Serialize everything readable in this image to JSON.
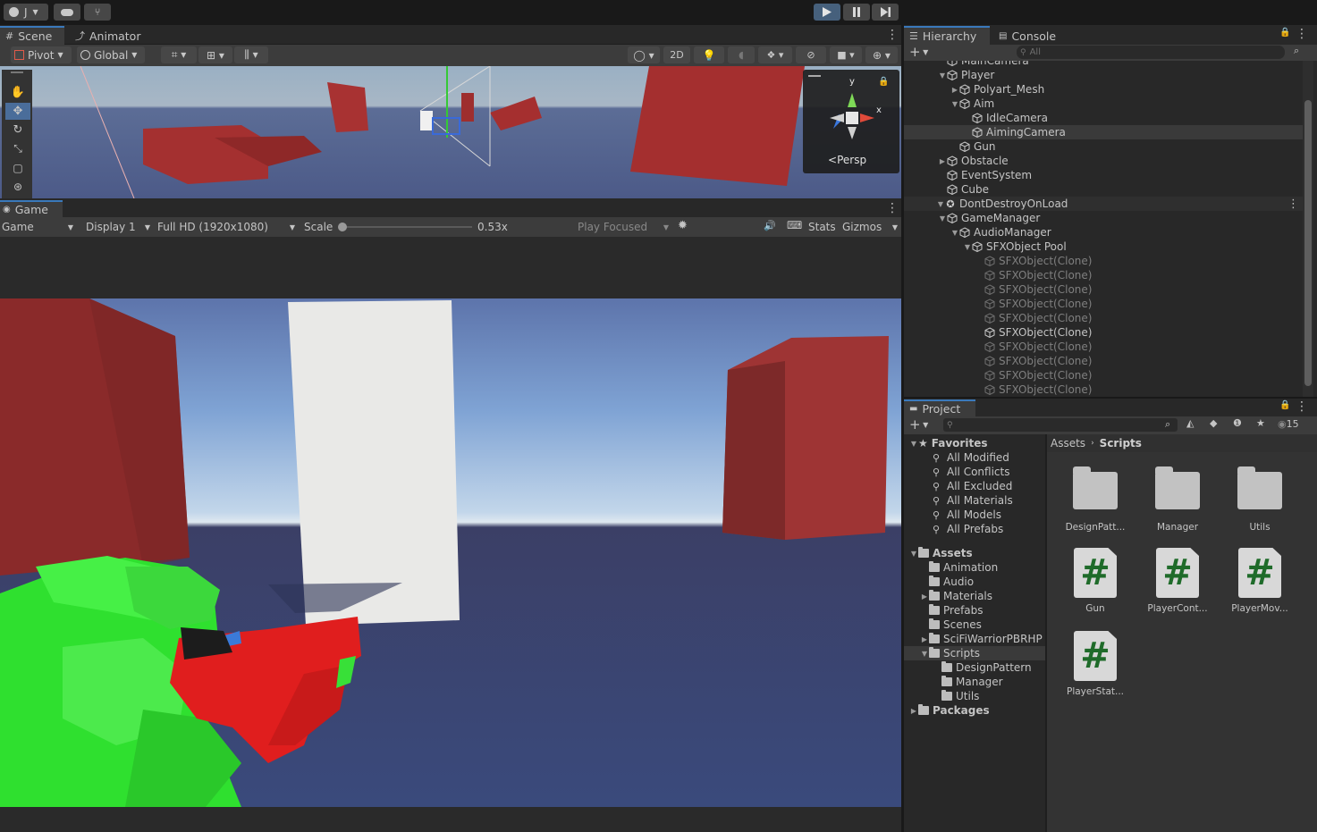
{
  "topbar": {
    "account_label": "J",
    "play": "play",
    "pause": "pause",
    "step": "step"
  },
  "scene_tabs": {
    "scene": "Scene",
    "animator": "Animator"
  },
  "scene_toolbar": {
    "pivot": "Pivot",
    "global": "Global",
    "two_d": "2D"
  },
  "gizmo": {
    "projection": "Persp",
    "y": "y",
    "x": "x",
    "z": "z"
  },
  "game_tab": "Game",
  "game_toolbar": {
    "view": "Game",
    "display": "Display 1",
    "resolution": "Full HD (1920x1080)",
    "scale_label": "Scale",
    "scale_value": "0.53x",
    "scale_fraction": 0.0,
    "play_mode": "Play Focused",
    "stats": "Stats",
    "gizmos": "Gizmos"
  },
  "hierarchy": {
    "tab": "Hierarchy",
    "console_tab": "Console",
    "search_placeholder": "All",
    "items": [
      {
        "label": "MainCamera",
        "depth": 1,
        "arrow": "",
        "dim": false
      },
      {
        "label": "Player",
        "depth": 1,
        "arrow": "down",
        "dim": false
      },
      {
        "label": "Polyart_Mesh",
        "depth": 2,
        "arrow": "right",
        "dim": false
      },
      {
        "label": "Aim",
        "depth": 2,
        "arrow": "down",
        "dim": false
      },
      {
        "label": "IdleCamera",
        "depth": 3,
        "arrow": "",
        "dim": false
      },
      {
        "label": "AimingCamera",
        "depth": 3,
        "arrow": "",
        "dim": false,
        "selected": true
      },
      {
        "label": "Gun",
        "depth": 2,
        "arrow": "",
        "dim": false
      },
      {
        "label": "Obstacle",
        "depth": 1,
        "arrow": "right",
        "dim": false
      },
      {
        "label": "EventSystem",
        "depth": 1,
        "arrow": "",
        "dim": false
      },
      {
        "label": "Cube",
        "depth": 1,
        "arrow": "",
        "dim": false
      },
      {
        "label": "DontDestroyOnLoad",
        "depth": 0,
        "arrow": "down",
        "dim": false,
        "scene": true
      },
      {
        "label": "GameManager",
        "depth": 1,
        "arrow": "down",
        "dim": false
      },
      {
        "label": "AudioManager",
        "depth": 2,
        "arrow": "down",
        "dim": false
      },
      {
        "label": "SFXObject Pool",
        "depth": 3,
        "arrow": "down",
        "dim": false
      },
      {
        "label": "SFXObject(Clone)",
        "depth": 4,
        "arrow": "",
        "dim": true
      },
      {
        "label": "SFXObject(Clone)",
        "depth": 4,
        "arrow": "",
        "dim": true
      },
      {
        "label": "SFXObject(Clone)",
        "depth": 4,
        "arrow": "",
        "dim": true
      },
      {
        "label": "SFXObject(Clone)",
        "depth": 4,
        "arrow": "",
        "dim": true
      },
      {
        "label": "SFXObject(Clone)",
        "depth": 4,
        "arrow": "",
        "dim": true
      },
      {
        "label": "SFXObject(Clone)",
        "depth": 4,
        "arrow": "",
        "dim": false
      },
      {
        "label": "SFXObject(Clone)",
        "depth": 4,
        "arrow": "",
        "dim": true
      },
      {
        "label": "SFXObject(Clone)",
        "depth": 4,
        "arrow": "",
        "dim": true
      },
      {
        "label": "SFXObject(Clone)",
        "depth": 4,
        "arrow": "",
        "dim": true
      },
      {
        "label": "SFXObject(Clone)",
        "depth": 4,
        "arrow": "",
        "dim": true
      }
    ]
  },
  "project": {
    "tab": "Project",
    "hidden_count": "15",
    "favorites_label": "Favorites",
    "favorites": [
      "All Modified",
      "All Conflicts",
      "All Excluded",
      "All Materials",
      "All Models",
      "All Prefabs"
    ],
    "assets_label": "Assets",
    "assets": [
      {
        "label": "Animation",
        "depth": 1,
        "arrow": ""
      },
      {
        "label": "Audio",
        "depth": 1,
        "arrow": ""
      },
      {
        "label": "Materials",
        "depth": 1,
        "arrow": "right"
      },
      {
        "label": "Prefabs",
        "depth": 1,
        "arrow": ""
      },
      {
        "label": "Scenes",
        "depth": 1,
        "arrow": ""
      },
      {
        "label": "SciFiWarriorPBRHP",
        "depth": 1,
        "arrow": "right"
      },
      {
        "label": "Scripts",
        "depth": 1,
        "arrow": "down",
        "selected": true
      },
      {
        "label": "DesignPattern",
        "depth": 2,
        "arrow": ""
      },
      {
        "label": "Manager",
        "depth": 2,
        "arrow": ""
      },
      {
        "label": "Utils",
        "depth": 2,
        "arrow": ""
      }
    ],
    "packages_label": "Packages",
    "breadcrumb": {
      "root": "Assets",
      "current": "Scripts"
    },
    "grid": [
      {
        "label": "DesignPatt...",
        "kind": "folder"
      },
      {
        "label": "Manager",
        "kind": "folder"
      },
      {
        "label": "Utils",
        "kind": "folder"
      },
      {
        "label": "Gun",
        "kind": "script"
      },
      {
        "label": "PlayerCont...",
        "kind": "script"
      },
      {
        "label": "PlayerMov...",
        "kind": "script"
      },
      {
        "label": "PlayerStat...",
        "kind": "script"
      }
    ],
    "script_glyph": "#"
  }
}
